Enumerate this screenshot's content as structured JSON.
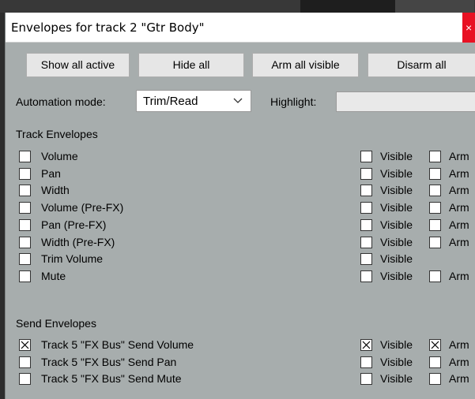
{
  "window": {
    "title": "Envelopes for track 2 \"Gtr Body\"",
    "close_glyph": "×"
  },
  "buttons": {
    "show_all_active": "Show all active",
    "hide_all": "Hide all",
    "arm_all_visible": "Arm all visible",
    "disarm_all": "Disarm all"
  },
  "automation": {
    "label": "Automation mode:",
    "value": "Trim/Read",
    "highlight_label": "Highlight:",
    "highlight_value": ""
  },
  "track_envelopes": {
    "heading": "Track Envelopes",
    "rows": [
      {
        "name": "Volume",
        "checked": false,
        "visible_label": "Visible",
        "visible": false,
        "arm_label": "Arm",
        "arm": false,
        "has_arm": true
      },
      {
        "name": "Pan",
        "checked": false,
        "visible_label": "Visible",
        "visible": false,
        "arm_label": "Arm",
        "arm": false,
        "has_arm": true
      },
      {
        "name": "Width",
        "checked": false,
        "visible_label": "Visible",
        "visible": false,
        "arm_label": "Arm",
        "arm": false,
        "has_arm": true
      },
      {
        "name": "Volume (Pre-FX)",
        "checked": false,
        "visible_label": "Visible",
        "visible": false,
        "arm_label": "Arm",
        "arm": false,
        "has_arm": true
      },
      {
        "name": "Pan (Pre-FX)",
        "checked": false,
        "visible_label": "Visible",
        "visible": false,
        "arm_label": "Arm",
        "arm": false,
        "has_arm": true
      },
      {
        "name": "Width (Pre-FX)",
        "checked": false,
        "visible_label": "Visible",
        "visible": false,
        "arm_label": "Arm",
        "arm": false,
        "has_arm": true
      },
      {
        "name": "Trim Volume",
        "checked": false,
        "visible_label": "Visible",
        "visible": false,
        "arm_label": "",
        "arm": false,
        "has_arm": false
      },
      {
        "name": "Mute",
        "checked": false,
        "visible_label": "Visible",
        "visible": false,
        "arm_label": "Arm",
        "arm": false,
        "has_arm": true
      }
    ]
  },
  "send_envelopes": {
    "heading": "Send Envelopes",
    "rows": [
      {
        "name": "Track 5 \"FX Bus\" Send Volume",
        "checked": true,
        "visible_label": "Visible",
        "visible": true,
        "arm_label": "Arm",
        "arm": true,
        "has_arm": true
      },
      {
        "name": "Track 5 \"FX Bus\" Send Pan",
        "checked": false,
        "visible_label": "Visible",
        "visible": false,
        "arm_label": "Arm",
        "arm": false,
        "has_arm": true
      },
      {
        "name": "Track 5 \"FX Bus\" Send Mute",
        "checked": false,
        "visible_label": "Visible",
        "visible": false,
        "arm_label": "Arm",
        "arm": false,
        "has_arm": true
      }
    ]
  }
}
